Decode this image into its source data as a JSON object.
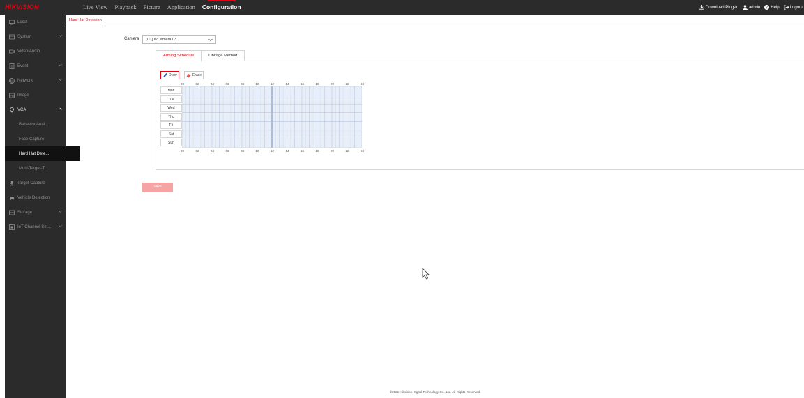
{
  "header": {
    "logo": "HIKVISION",
    "nav": [
      "Live View",
      "Playback",
      "Picture",
      "Application",
      "Configuration"
    ],
    "active_nav": "Configuration",
    "download_plugin": "Download Plug-in",
    "user": "admin",
    "help": "Help",
    "logout": "Logout"
  },
  "sidebar": {
    "items": [
      {
        "label": "Local",
        "icon": "monitor-icon",
        "has_chevron": false
      },
      {
        "label": "System",
        "icon": "system-icon",
        "has_chevron": true
      },
      {
        "label": "Video/Audio",
        "icon": "video-icon",
        "has_chevron": false
      },
      {
        "label": "Event",
        "icon": "event-icon",
        "has_chevron": true
      },
      {
        "label": "Network",
        "icon": "globe-icon",
        "has_chevron": true
      },
      {
        "label": "Image",
        "icon": "image-icon",
        "has_chevron": false
      },
      {
        "label": "VCA",
        "icon": "vca-icon",
        "has_chevron": true,
        "expanded": true
      },
      {
        "label": "Behavior Anal...",
        "sub": true
      },
      {
        "label": "Face Capture",
        "sub": true
      },
      {
        "label": "Hard Hat Dete...",
        "sub": true,
        "active": true
      },
      {
        "label": "Multi-Target-T...",
        "sub": true
      },
      {
        "label": "Target Capture",
        "icon": "target-icon",
        "has_chevron": false
      },
      {
        "label": "Vehicle Detection",
        "icon": "vehicle-icon",
        "has_chevron": false
      },
      {
        "label": "Storage",
        "icon": "storage-icon",
        "has_chevron": true
      },
      {
        "label": "IoT Channel Set...",
        "icon": "iot-icon",
        "has_chevron": true
      }
    ]
  },
  "page_tab": "Hard Hat Detection",
  "camera": {
    "label": "Camera",
    "value": "[D1] IPCamera 03"
  },
  "tabs": [
    "Arming Schedule",
    "Linkage Method"
  ],
  "active_tab": "Arming Schedule",
  "tools": {
    "draw": "Draw",
    "erase": "Erase"
  },
  "schedule": {
    "days": [
      "Mon",
      "Tue",
      "Wed",
      "Thu",
      "Fri",
      "Sat",
      "Sun"
    ],
    "hour_ticks": [
      "00",
      "02",
      "04",
      "06",
      "08",
      "10",
      "12",
      "14",
      "16",
      "18",
      "20",
      "22",
      "24"
    ],
    "armed_all_day": true
  },
  "save_label": "Save",
  "footer": "©2021 Hikvision Digital Technology Co., Ltd. All Rights Reserved.",
  "colors": {
    "accent": "#e60012",
    "topbar": "#2b2b2b",
    "grid_fill": "#e8eff9"
  }
}
